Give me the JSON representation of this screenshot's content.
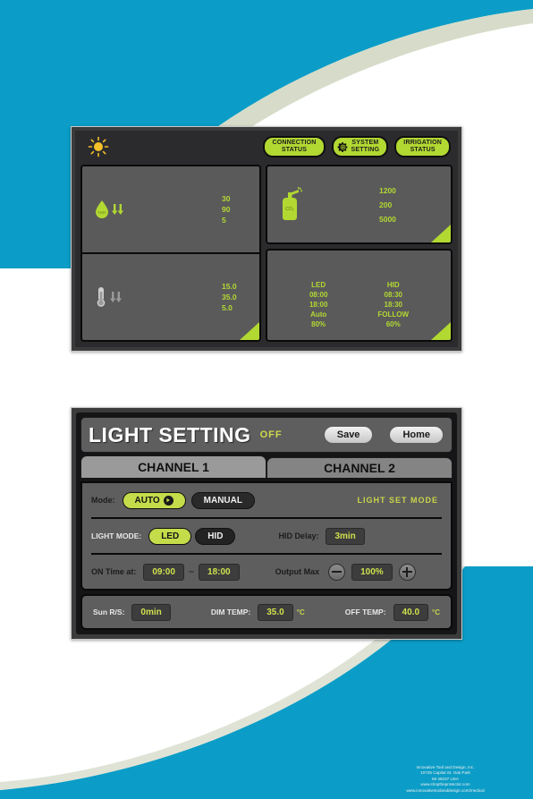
{
  "dashboard": {
    "sun_icon": "sun-icon",
    "status_buttons": [
      {
        "name": "connection-status",
        "line1": "CONNECTION",
        "line2": "STATUS",
        "icon": null
      },
      {
        "name": "system-setting",
        "line1": "SYSTEM",
        "line2": "SETTING",
        "icon": "gear-icon"
      },
      {
        "name": "irrigation-status",
        "line1": "IRRIGATION",
        "line2": "STATUS",
        "icon": null
      }
    ],
    "humidity": {
      "icon": "humidity-droplet-icon",
      "unit_label": "%rH",
      "values": [
        "30",
        "90",
        "5"
      ]
    },
    "temperature": {
      "icon": "thermometer-icon",
      "values": [
        "15.0",
        "35.0",
        "5.0"
      ]
    },
    "co2": {
      "icon": "co2-bottle-icon",
      "label": "CO₂",
      "values": [
        "1200",
        "200",
        "5000"
      ]
    },
    "light": {
      "led": {
        "title": "LED",
        "on_time": "08:00",
        "off_time": "18:00",
        "mode": "Auto",
        "output": "80%"
      },
      "hid": {
        "title": "HID",
        "on_time": "08:30",
        "off_time": "18:30",
        "mode": "FOLLOW",
        "output": "60%"
      }
    }
  },
  "light_setting": {
    "title": "LIGHT SETTING",
    "power_state": "OFF",
    "save_label": "Save",
    "home_label": "Home",
    "tabs": [
      {
        "label": "CHANNEL 1",
        "active": true
      },
      {
        "label": "CHANNEL 2",
        "active": false
      }
    ],
    "mode_row": {
      "label": "Mode:",
      "option_auto": "AUTO",
      "option_manual": "MANUAL",
      "selected": "AUTO",
      "right_label": "LIGHT SET MODE"
    },
    "light_mode_row": {
      "label": "LIGHT MODE:",
      "option_led": "LED",
      "option_hid": "HID",
      "selected": "LED",
      "hid_delay_label": "HID Delay:",
      "hid_delay_value": "3min"
    },
    "on_time_row": {
      "label": "ON Time at:",
      "start": "09:00",
      "dash": "–",
      "end": "18:00",
      "output_label": "Output Max",
      "minus_icon": "minus-icon",
      "output_value": "100%",
      "plus_icon": "plus-icon"
    },
    "footer_row": {
      "sun_rs_label": "Sun R/S:",
      "sun_rs_value": "0min",
      "dim_temp_label": "DIM TEMP:",
      "dim_temp_value": "35.0",
      "dim_temp_unit": "°C",
      "off_temp_label": "OFF TEMP:",
      "off_temp_value": "40.0",
      "off_temp_unit": "°C"
    }
  },
  "page_footer": {
    "line1": "Innovative Tool and Design, Inc.",
    "line2": "10725 Capital St. Oak Park",
    "line3": "MI 48237 USA",
    "line4": "www.shoptheprotector.com",
    "line5": "www.innovativetoolanddesign.com/medical"
  },
  "colors": {
    "accent_green": "#b2d832",
    "brand_cyan": "#0b9dc7",
    "panel_gray": "#5a5a5a",
    "dark": "#2b2b2e"
  }
}
